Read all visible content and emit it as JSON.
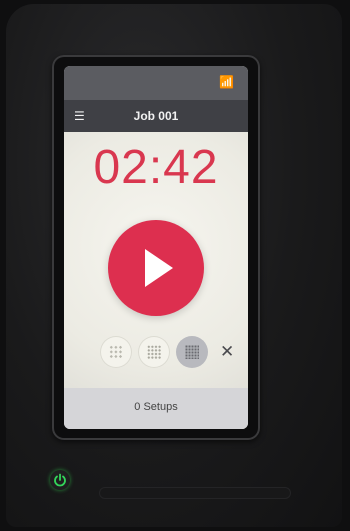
{
  "header": {
    "title": "Job 001",
    "status_icons": "wifi-icon battery-icon battery-icon more-icon"
  },
  "timer": {
    "display": "02:42"
  },
  "controls": {
    "play_icon": "play-icon",
    "modes": [
      "dots-coarse-icon",
      "dots-medium-icon",
      "dots-fine-icon"
    ],
    "close_glyph": "✕"
  },
  "footer": {
    "label": "0 Setups"
  },
  "colors": {
    "accent_red": "#dd2f4f",
    "power_led": "#33d65a"
  }
}
